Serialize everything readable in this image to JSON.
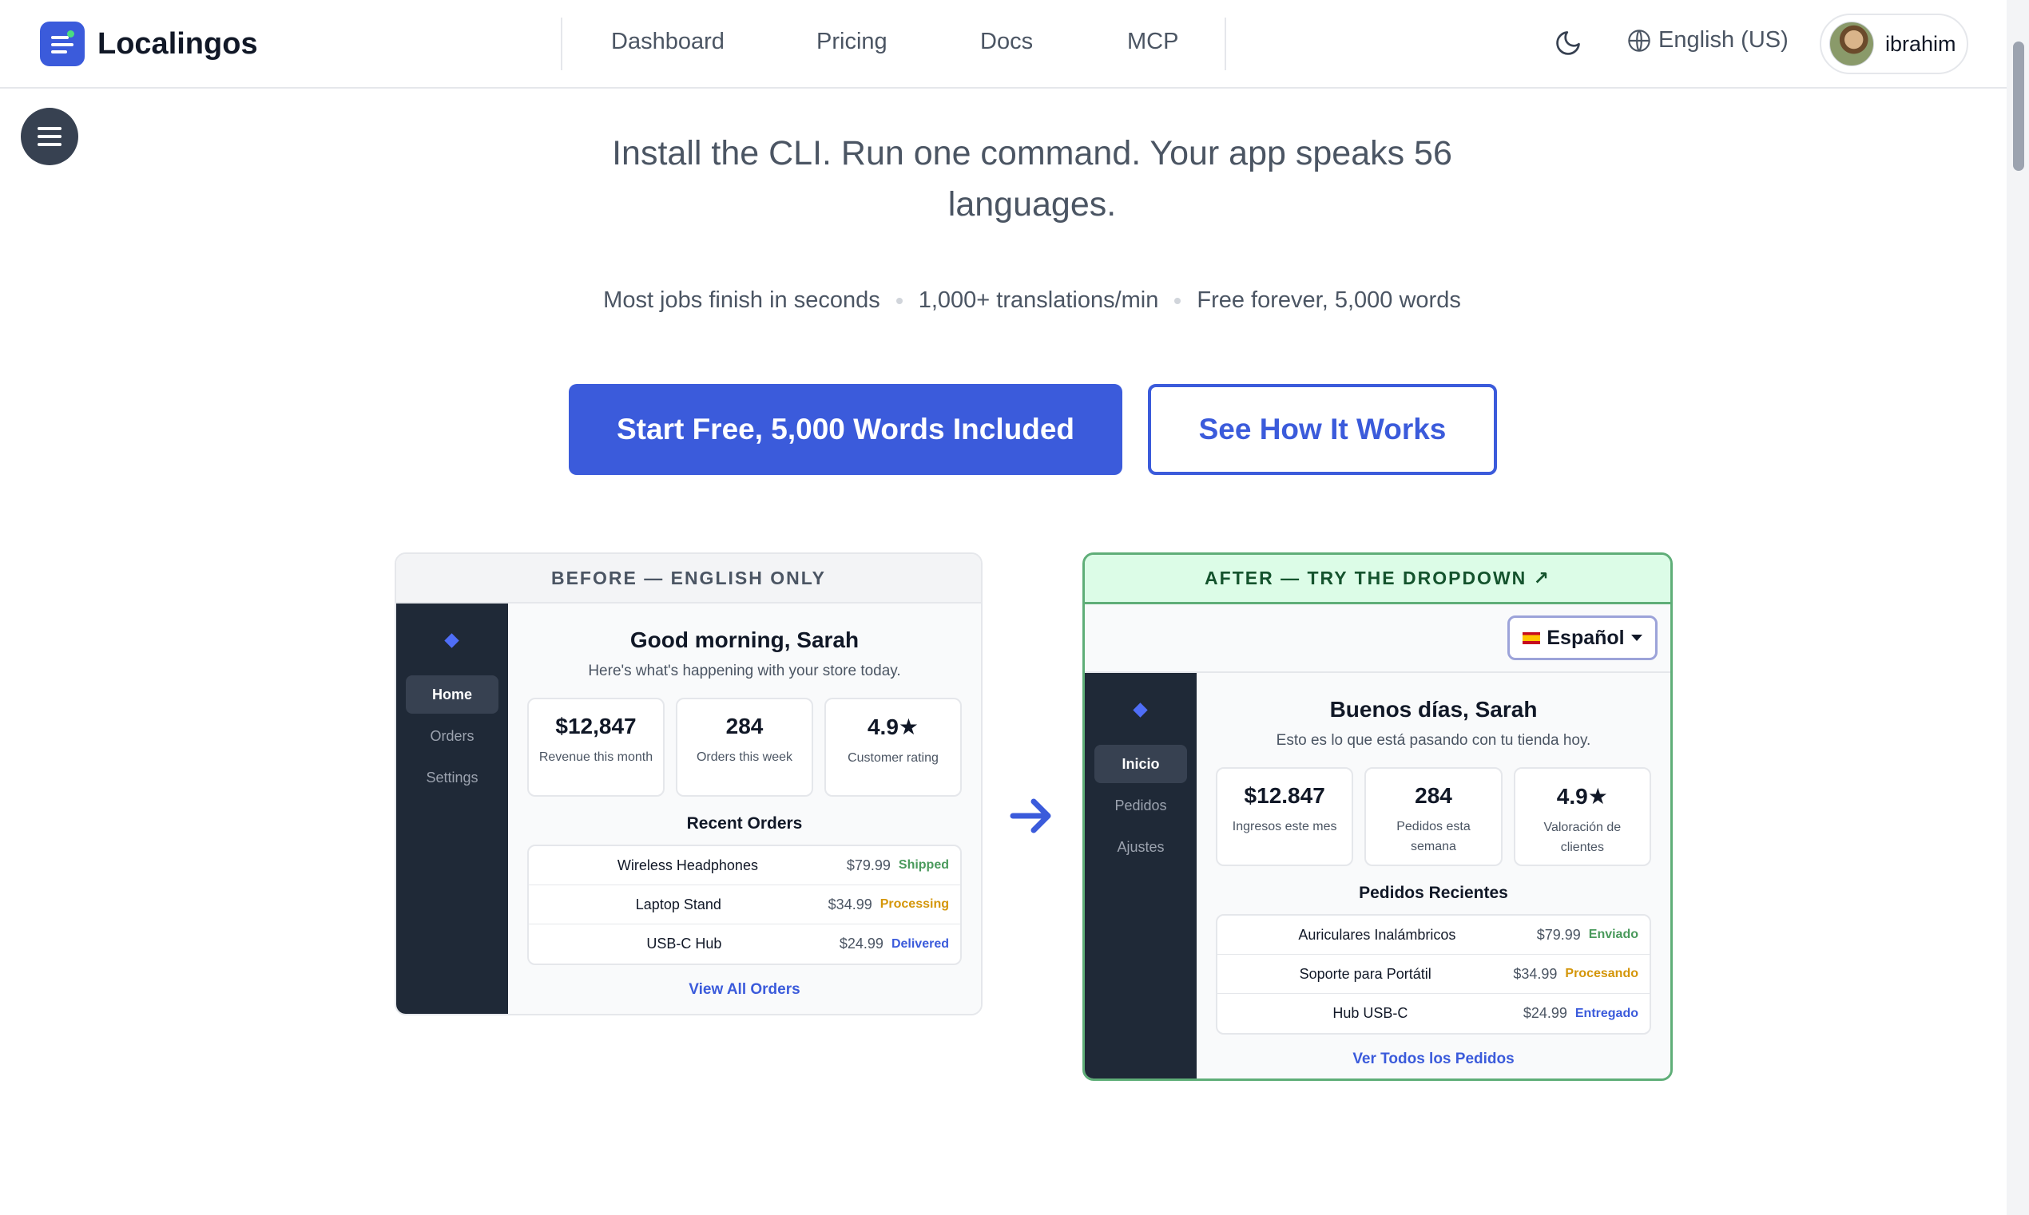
{
  "app": {
    "name": "Localingos"
  },
  "nav": [
    "Dashboard",
    "Pricing",
    "Docs",
    "MCP"
  ],
  "language": "English (US)",
  "user": {
    "name": "ibrahim"
  },
  "hero": {
    "headline": "Install the CLI. Run one command. Your app speaks 56 languages.",
    "features": [
      "Most jobs finish in seconds",
      "1,000+ translations/min",
      "Free forever, 5,000 words"
    ],
    "primary_cta": "Start Free, 5,000 Words Included",
    "secondary_cta": "See How It Works"
  },
  "colors": {
    "accent": "#3b5bdb",
    "success": "#5fae78",
    "shipped": "#4a9a5c",
    "processing": "#d4960a",
    "delivered": "#3b5bdb"
  },
  "before": {
    "header": "BEFORE — ENGLISH ONLY",
    "sidebar": [
      "Home",
      "Orders",
      "Settings"
    ],
    "greeting": "Good morning, Sarah",
    "subtitle": "Here's what's happening with your store today.",
    "stats": [
      {
        "value": "$12,847",
        "label": "Revenue this month"
      },
      {
        "value": "284",
        "label": "Orders this week"
      },
      {
        "value": "4.9★",
        "label": "Customer rating"
      }
    ],
    "recent_title": "Recent Orders",
    "orders": [
      {
        "name": "Wireless Headphones",
        "price": "$79.99",
        "status": "Shipped"
      },
      {
        "name": "Laptop Stand",
        "price": "$34.99",
        "status": "Processing"
      },
      {
        "name": "USB-C Hub",
        "price": "$24.99",
        "status": "Delivered"
      }
    ],
    "view_all": "View All Orders"
  },
  "after": {
    "header": "AFTER — TRY THE DROPDOWN ↗",
    "language_select": "Español",
    "sidebar": [
      "Inicio",
      "Pedidos",
      "Ajustes"
    ],
    "greeting": "Buenos días, Sarah",
    "subtitle": "Esto es lo que está pasando con tu tienda hoy.",
    "stats": [
      {
        "value": "$12.847",
        "label": "Ingresos este mes"
      },
      {
        "value": "284",
        "label": "Pedidos esta semana"
      },
      {
        "value": "4.9★",
        "label": "Valoración de clientes"
      }
    ],
    "recent_title": "Pedidos Recientes",
    "orders": [
      {
        "name": "Auriculares Inalámbricos",
        "price": "$79.99",
        "status": "Enviado"
      },
      {
        "name": "Soporte para Portátil",
        "price": "$34.99",
        "status": "Procesando"
      },
      {
        "name": "Hub USB-C",
        "price": "$24.99",
        "status": "Entregado"
      }
    ],
    "view_all": "Ver Todos los Pedidos"
  }
}
